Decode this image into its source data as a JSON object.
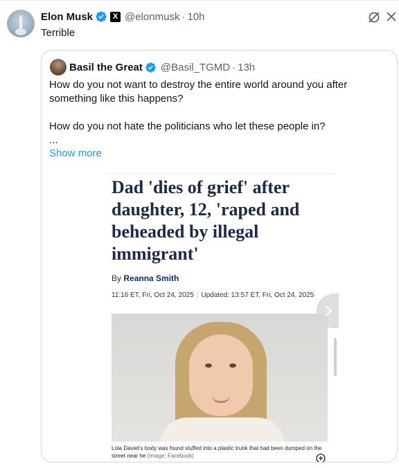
{
  "post": {
    "author_name": "Elon Musk",
    "author_handle": "@elonmusk",
    "separator": "·",
    "time": "10h",
    "text": "Terrible",
    "x_badge": "X"
  },
  "quote": {
    "author_name": "Basil the Great",
    "author_handle": "@Basil_TGMD",
    "separator": "·",
    "time": "13h",
    "paragraph1": "How do you not want to destroy the entire world around you after something like this happens?",
    "paragraph2": "How do you not hate the politicians who let these people in?",
    "ellipsis": "...",
    "show_more": "Show more"
  },
  "article": {
    "headline": "Dad 'dies of grief' after daughter, 12, 'raped and beheaded by illegal immigrant'",
    "byline_prefix": "By",
    "byline_author": "Reanna Smith",
    "published": "11:16 ET, Fri, Oct 24, 2025",
    "date_separator": "|",
    "updated": "Updated: 13:57 ET, Fri, Oct 24, 2025",
    "caption": "Lola Daviet's body was found stuffed into a plastic trunk that had been dumped on the street near he",
    "caption_credit": "(Image: Facebook)"
  },
  "icons": {
    "verified": "verified-badge-icon",
    "grok": "grok-icon",
    "close": "close-icon",
    "next": "chevron-right-icon",
    "expand": "plus-circle-icon"
  },
  "colors": {
    "link": "#1d9bf0",
    "secondary_text": "#536471",
    "verified": "#1d9bf0",
    "headline": "#1b2a49"
  }
}
